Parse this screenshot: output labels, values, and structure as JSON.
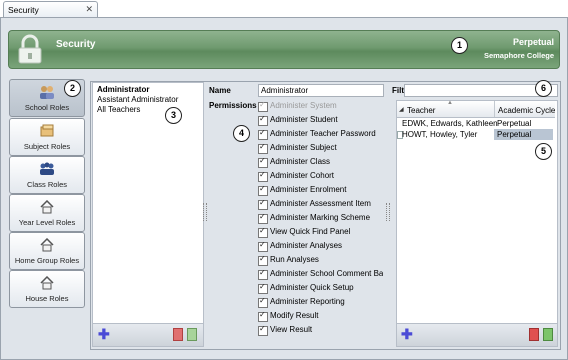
{
  "tab": {
    "title": "Security",
    "close_glyph": "✕"
  },
  "header": {
    "title": "Security",
    "cycle": "Perpetual",
    "school": "Semaphore College"
  },
  "nav": [
    {
      "label": "School Roles",
      "icon": "users-icon"
    },
    {
      "label": "Subject Roles",
      "icon": "books-icon"
    },
    {
      "label": "Class Roles",
      "icon": "people-icon"
    },
    {
      "label": "Year Level Roles",
      "icon": "house-icon"
    },
    {
      "label": "Home Group Roles",
      "icon": "house-icon"
    },
    {
      "label": "House Roles",
      "icon": "house-icon"
    }
  ],
  "roles": [
    "Administrator",
    "Assistant Administrator",
    "All Teachers"
  ],
  "form": {
    "name_label": "Name",
    "name_value": "Administrator",
    "permissions_label": "Permissions"
  },
  "permissions": [
    "Administer System",
    "Administer Student",
    "Administer Teacher Password",
    "Administer Subject",
    "Administer Class",
    "Administer Cohort",
    "Administer Enrolment",
    "Administer Assessment Item",
    "Administer Marking Scheme",
    "View Quick Find Panel",
    "Administer Analyses",
    "Run Analyses",
    "Administer School Comment Banl",
    "Administer Quick Setup",
    "Administer Reporting",
    "Modify Result",
    "View Result"
  ],
  "filter": {
    "label": "Filter",
    "value": ""
  },
  "grid": {
    "columns": [
      "Teacher",
      "Academic Cycle"
    ],
    "rows": [
      [
        "EDWK, Edwards, Kathleen",
        "Perpetual"
      ],
      [
        "HOWT, Howley, Tyler",
        "Perpetual"
      ]
    ]
  },
  "callouts": [
    "1",
    "2",
    "3",
    "4",
    "5",
    "6"
  ]
}
